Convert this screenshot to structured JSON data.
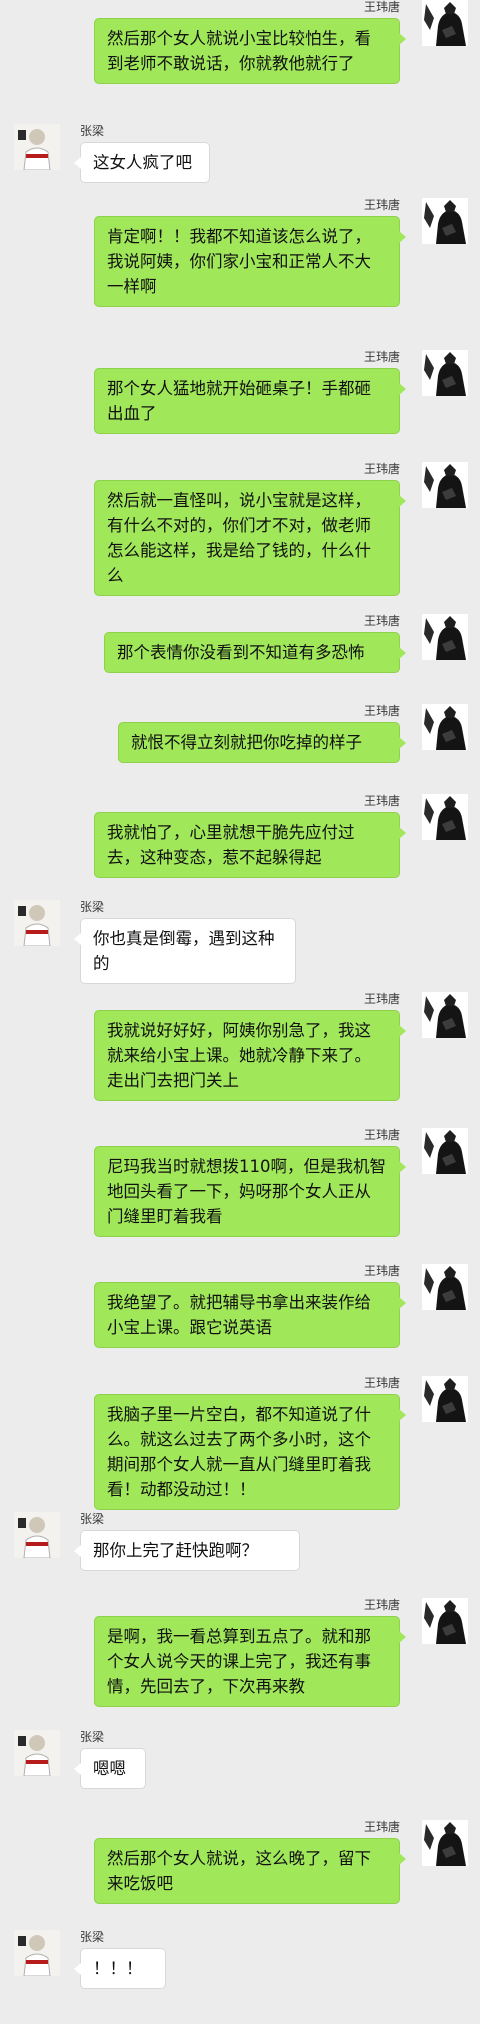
{
  "chat": {
    "contacts": {
      "me": "王玮唐",
      "other": "张梁"
    },
    "messages": [
      {
        "sender": "王玮唐",
        "side": "right",
        "text": "然后那个女人就说小宝比较怕生，看到老师不敢说话，你就教他就行了"
      },
      {
        "sender": "张梁",
        "side": "left",
        "text": "这女人疯了吧"
      },
      {
        "sender": "王玮唐",
        "side": "right",
        "text": "肯定啊！！我都不知道该怎么说了，我说阿姨，你们家小宝和正常人不大一样啊"
      },
      {
        "sender": "王玮唐",
        "side": "right",
        "text": "那个女人猛地就开始砸桌子！手都砸出血了"
      },
      {
        "sender": "王玮唐",
        "side": "right",
        "text": "然后就一直怪叫，说小宝就是这样，有什么不对的，你们才不对，做老师怎么能这样，我是给了钱的，什么什么"
      },
      {
        "sender": "王玮唐",
        "side": "right",
        "text": "那个表情你没看到不知道有多恐怖"
      },
      {
        "sender": "王玮唐",
        "side": "right",
        "text": "就恨不得立刻就把你吃掉的样子"
      },
      {
        "sender": "王玮唐",
        "side": "right",
        "text": "我就怕了，心里就想干脆先应付过去，这种变态，惹不起躲得起"
      },
      {
        "sender": "张梁",
        "side": "left",
        "text": "你也真是倒霉，遇到这种的"
      },
      {
        "sender": "王玮唐",
        "side": "right",
        "text": "我就说好好好，阿姨你别急了，我这就来给小宝上课。她就冷静下来了。走出门去把门关上"
      },
      {
        "sender": "王玮唐",
        "side": "right",
        "text": "尼玛我当时就想拨110啊，但是我机智地回头看了一下，妈呀那个女人正从门缝里盯着我看"
      },
      {
        "sender": "王玮唐",
        "side": "right",
        "text": "我绝望了。就把辅导书拿出来装作给小宝上课。跟它说英语"
      },
      {
        "sender": "王玮唐",
        "side": "right",
        "text": "我脑子里一片空白，都不知道说了什么。就这么过去了两个多小时，这个期间那个女人就一直从门缝里盯着我看！动都没动过！！"
      },
      {
        "sender": "张梁",
        "side": "left",
        "text": "那你上完了赶快跑啊？"
      },
      {
        "sender": "王玮唐",
        "side": "right",
        "text": "是啊，我一看总算到五点了。就和那个女人说今天的课上完了，我还有事情，先回去了，下次再来教"
      },
      {
        "sender": "张梁",
        "side": "left",
        "text": "嗯嗯"
      },
      {
        "sender": "王玮唐",
        "side": "right",
        "text": "然后那个女人就说，这么晚了，留下来吃饭吧"
      },
      {
        "sender": "张梁",
        "side": "left",
        "text": "！！！"
      }
    ]
  }
}
